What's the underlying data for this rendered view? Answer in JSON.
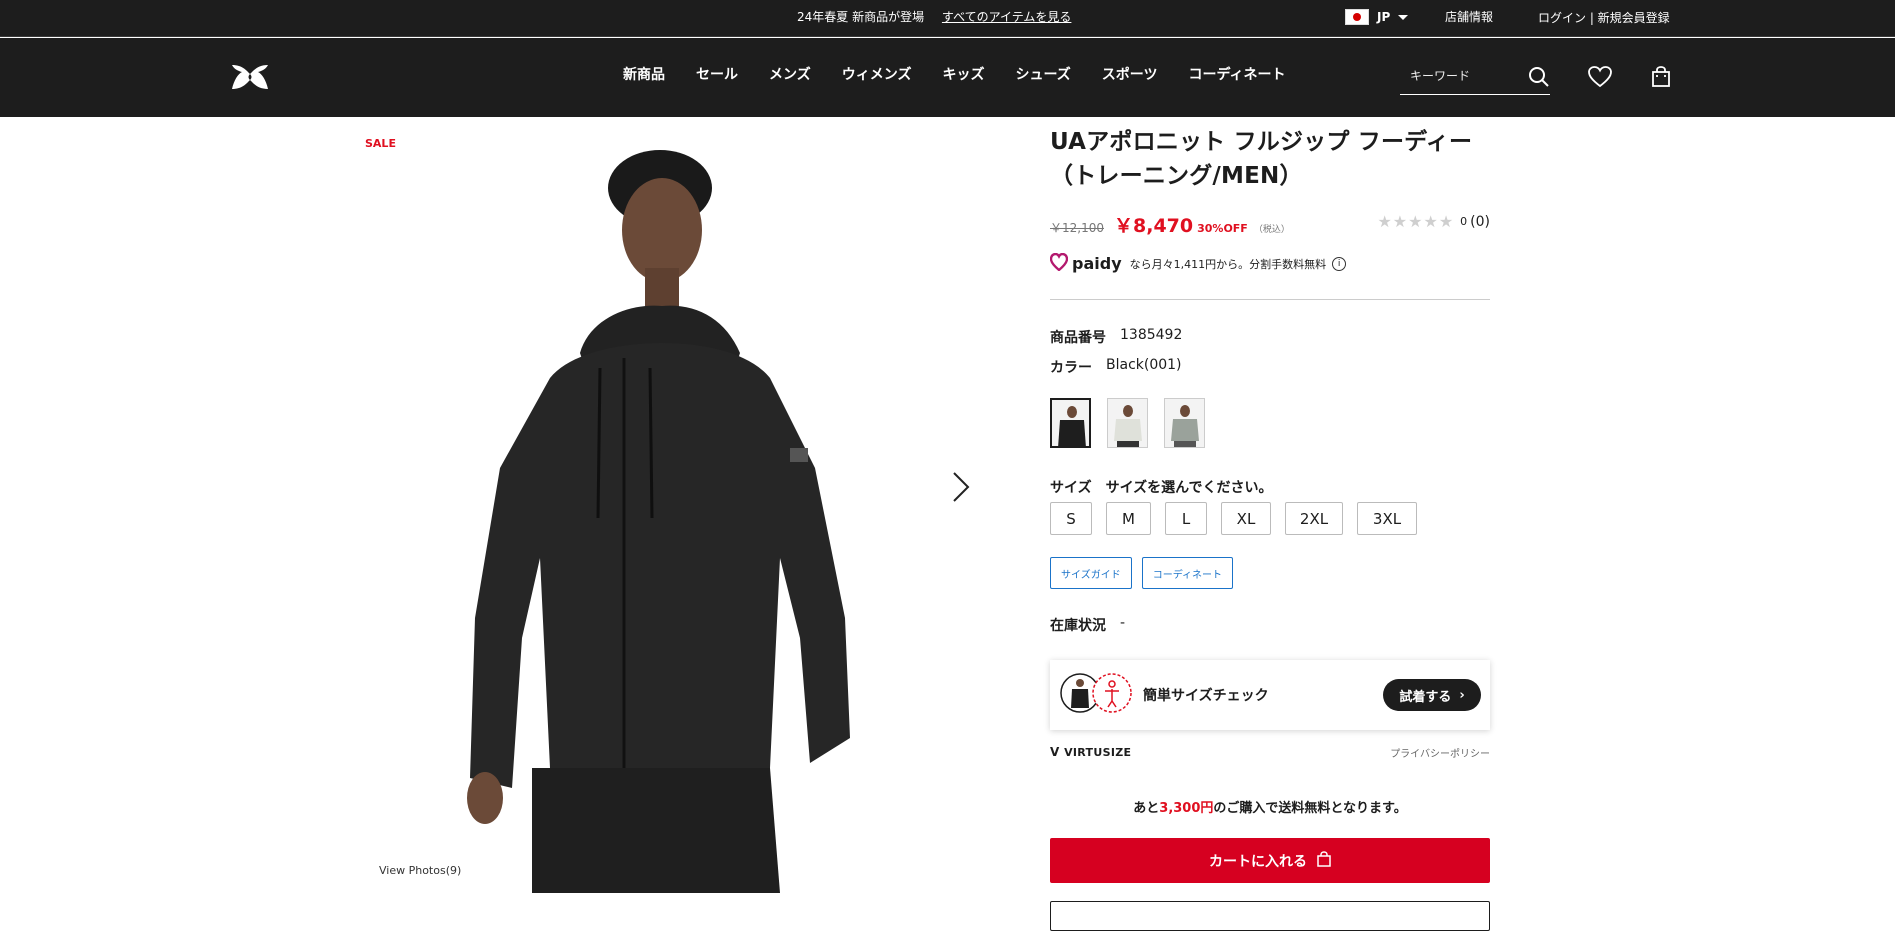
{
  "topbar": {
    "promo_text": "24年春夏 新商品が登場",
    "promo_link": "すべてのアイテムを見る",
    "region": "JP",
    "store": "店舗情報",
    "login": "ログイン | 新規会員登録"
  },
  "nav": {
    "items": [
      "新商品",
      "セール",
      "メンズ",
      "ウィメンズ",
      "キッズ",
      "シューズ",
      "スポーツ",
      "コーディネート"
    ],
    "search_placeholder": "キーワード"
  },
  "product": {
    "sale_badge": "SALE",
    "view_photos": "View Photos(9)",
    "title_line1": "UAアポロニット フルジップ フーディー",
    "title_line2": "（トレーニング/MEN）",
    "old_price": "￥12,100",
    "new_price": "￥8,470",
    "discount": "30%OFF",
    "tax_note": "（税込）",
    "rating_count": "0",
    "review_count": "(0)",
    "paidy_brand": "paidy",
    "paidy_text": "なら月々1,411円から。分割手数料無料",
    "sku_label": "商品番号",
    "sku_value": "1385492",
    "color_label": "カラー",
    "color_value": "Black(001)",
    "size_label": "サイズ",
    "size_prompt": "サイズを選んでください。",
    "sizes": [
      "S",
      "M",
      "L",
      "XL",
      "2XL",
      "3XL"
    ],
    "size_guide": "サイズガイド",
    "coordinate": "コーディネート",
    "stock_label": "在庫状況",
    "stock_value": "-",
    "vs_title": "簡単サイズチェック",
    "vs_button": "試着する",
    "vs_brand": "VIRTUSIZE",
    "privacy": "プライバシーポリシー",
    "ship_prefix": "あと",
    "ship_amount": "3,300円",
    "ship_suffix": "のご購入で送料無料となります。",
    "cart_button": "カートに入れる"
  },
  "colors": {
    "accent_red": "#d60020",
    "header_bg": "#1d1d1d",
    "link_blue": "#1a73c9"
  }
}
